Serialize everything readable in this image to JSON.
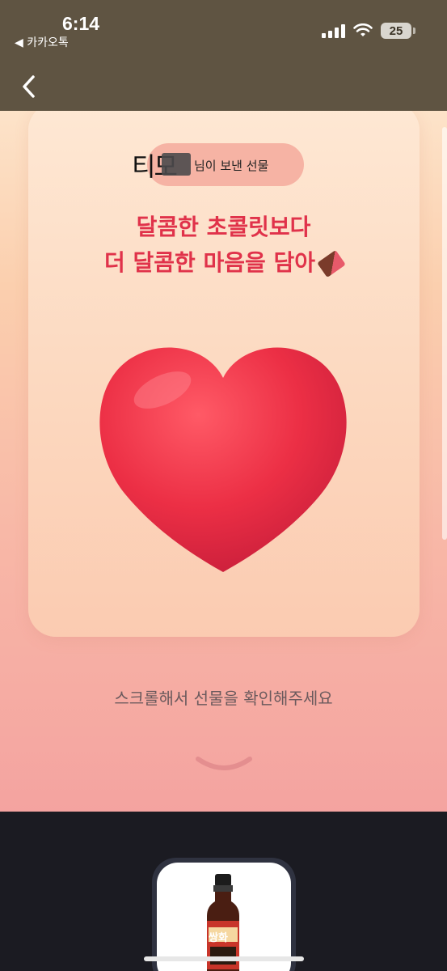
{
  "status_bar": {
    "time": "6:14",
    "back_app": "◀ 카카오톡",
    "battery": "25"
  },
  "nav": {
    "back_icon": "chevron-left-icon"
  },
  "gift": {
    "sender_name": "티모",
    "sender_suffix": "님이 보낸 선물",
    "headline_line1": "달콤한 초콜릿보다",
    "headline_line2": "더 달콤한 마음을 담아",
    "headline_emoji": "chocolate-bar-icon",
    "hero_image": "heart-icon",
    "scroll_hint": "스크롤해서 선물을 확인해주세요",
    "scroll_icon": "chevron-down-icon",
    "product_label": "쌍화"
  },
  "colors": {
    "headline": "#e0324a",
    "statusbar_bg": "#5f5442",
    "bottom_bg": "#1b1b22"
  }
}
